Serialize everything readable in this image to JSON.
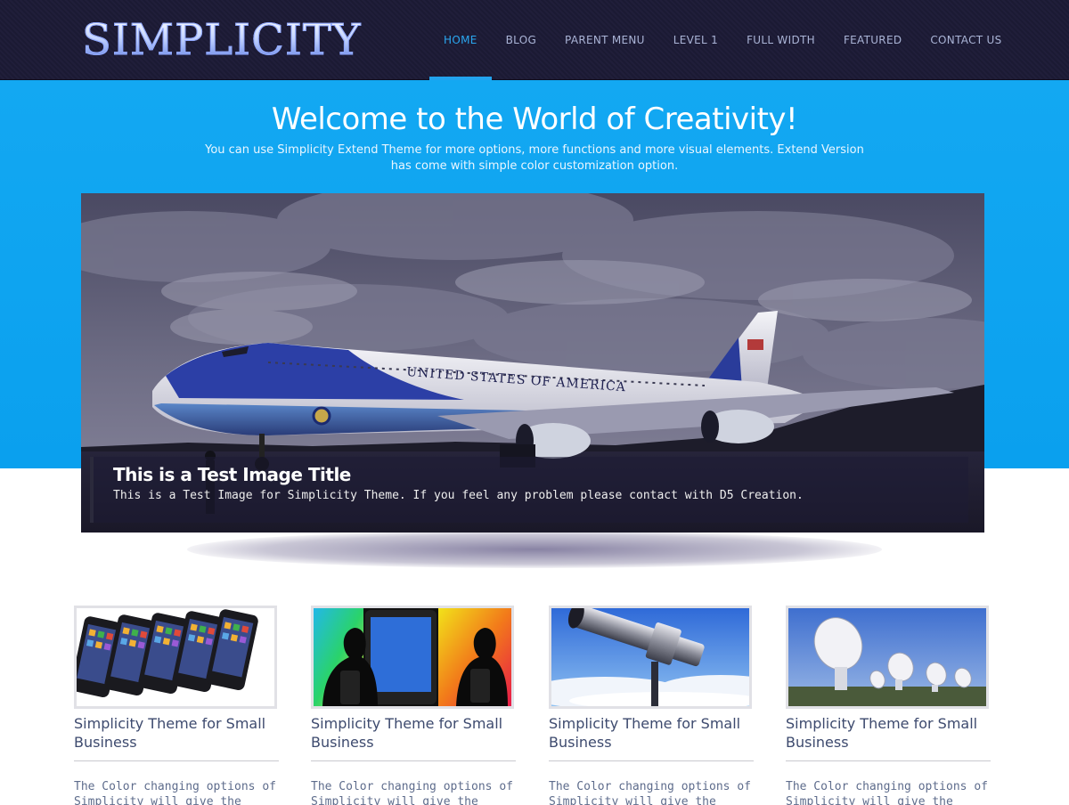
{
  "header": {
    "logo_text": "SIMPLICITY",
    "nav": [
      {
        "label": "HOME",
        "active": true
      },
      {
        "label": "BLOG",
        "active": false
      },
      {
        "label": "PARENT MENU",
        "active": false
      },
      {
        "label": "LEVEL 1",
        "active": false
      },
      {
        "label": "FULL WIDTH",
        "active": false
      },
      {
        "label": "FEATURED",
        "active": false
      },
      {
        "label": "CONTACT US",
        "active": false
      }
    ]
  },
  "hero": {
    "title": "Welcome to the World of Creativity!",
    "subtitle": "You can use Simplicity Extend Theme for more options, more functions and more visual elements. Extend Version has come with simple color customization option."
  },
  "slider": {
    "image_text": "UNITED STATES OF AMERICA",
    "caption_title": "This is a Test Image Title",
    "caption_text": "This is a Test Image for Simplicity Theme. If you feel any problem please contact with D5 Creation."
  },
  "features": [
    {
      "icon": "smartphones-image",
      "title": "Simplicity Theme for Small Business",
      "text": "The Color changing options of Simplicity will give the WordPress"
    },
    {
      "icon": "silhouettes-phones-image",
      "title": "Simplicity Theme for Small Business",
      "text": "The Color changing options of Simplicity will give the WordPress"
    },
    {
      "icon": "telescope-image",
      "title": "Simplicity Theme for Small Business",
      "text": "The Color changing options of Simplicity will give the WordPress"
    },
    {
      "icon": "satellite-dishes-image",
      "title": "Simplicity Theme for Small Business",
      "text": "The Color changing options of Simplicity will give the WordPress"
    }
  ],
  "colors": {
    "header_bg": "#1b1a33",
    "accent": "#22a3ee",
    "hero_bg": "#0aa0ee",
    "feature_title": "#3d4a6e"
  }
}
